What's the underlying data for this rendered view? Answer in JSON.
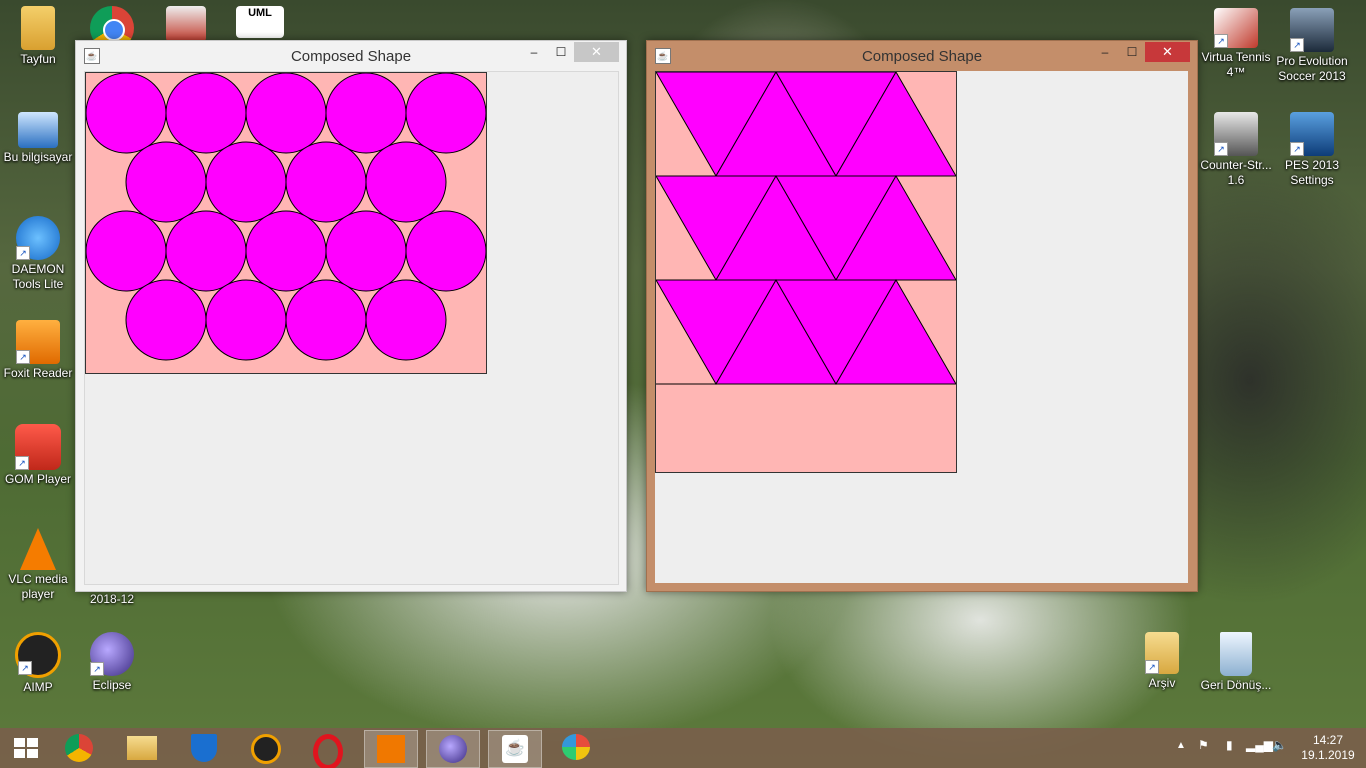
{
  "desktop_icons": [
    {
      "label": "Tayfun",
      "icon": "user-folder-icon",
      "color": "#e8b040"
    },
    {
      "label": "",
      "icon": "chrome-icon",
      "color": "#4285f4"
    },
    {
      "label": "",
      "icon": "printer-tool-icon",
      "color": "#c0392b"
    },
    {
      "label": "",
      "icon": "uml-icon",
      "color": "#ffffff"
    },
    {
      "label": "Bu bilgisayar",
      "icon": "computer-icon",
      "color": "#3a86d6"
    },
    {
      "label": "DAEMON Tools Lite",
      "icon": "daemon-tools-icon",
      "color": "#2f8de4"
    },
    {
      "label": "Foxit Reader",
      "icon": "foxit-reader-icon",
      "color": "#f39c12"
    },
    {
      "label": "GOM Player",
      "icon": "gom-player-icon",
      "color": "#e74c3c"
    },
    {
      "label": "VLC media player",
      "icon": "vlc-icon",
      "color": "#f57c00"
    },
    {
      "label": "2018-12",
      "icon": "folder-icon",
      "color": "#e8b040"
    },
    {
      "label": "AIMP",
      "icon": "aimp-icon",
      "color": "#f0a000"
    },
    {
      "label": "Eclipse",
      "icon": "eclipse-icon",
      "color": "#4b3b8f"
    },
    {
      "label": "Virtua Tennis 4™",
      "icon": "virtua-tennis-icon",
      "color": "#c0392b"
    },
    {
      "label": "Pro Evolution Soccer 2013",
      "icon": "pes2013-icon",
      "color": "#2c3e50"
    },
    {
      "label": "Counter-Str... 1.6",
      "icon": "counter-strike-icon",
      "color": "#6d6d6d"
    },
    {
      "label": "PES 2013 Settings",
      "icon": "pes2013-settings-icon",
      "color": "#1f5fa8"
    },
    {
      "label": "Arşiv",
      "icon": "archive-folder-icon",
      "color": "#e8c060"
    },
    {
      "label": "Geri Dönüş...",
      "icon": "recycle-bin-icon",
      "color": "#b0c8e0"
    }
  ],
  "windows": [
    {
      "title": "Composed Shape",
      "minimize": "‒",
      "maximize": "☐",
      "close": "✕",
      "shape_fill": "#ff00ff",
      "background": "#ffb6b4",
      "shape": "circles"
    },
    {
      "title": "Composed Shape",
      "minimize": "‒",
      "maximize": "☐",
      "close": "✕",
      "shape_fill": "#ff00ff",
      "background": "#ffb6b4",
      "shape": "triangles"
    }
  ],
  "taskbar": {
    "items": [
      {
        "icon": "chrome-icon"
      },
      {
        "icon": "file-explorer-icon"
      },
      {
        "icon": "windows-defender-icon"
      },
      {
        "icon": "aimp-icon"
      },
      {
        "icon": "opera-icon"
      },
      {
        "icon": "foxit-reader-icon"
      },
      {
        "icon": "eclipse-icon"
      },
      {
        "icon": "java-icon"
      },
      {
        "icon": "paint-icon"
      }
    ],
    "clock_time": "14:27",
    "clock_date": "19.1.2019"
  }
}
